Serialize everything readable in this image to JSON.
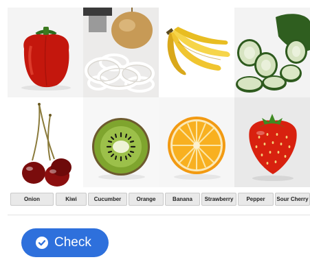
{
  "images": [
    {
      "name": "bell pepper"
    },
    {
      "name": "onion"
    },
    {
      "name": "banana"
    },
    {
      "name": "cucumber"
    },
    {
      "name": "sour cherry"
    },
    {
      "name": "kiwi"
    },
    {
      "name": "orange"
    },
    {
      "name": "strawberry"
    }
  ],
  "labels": [
    "Onion",
    "Kiwi",
    "Cucumber",
    "Orange",
    "Banana",
    "Strawberry",
    "Pepper",
    "Sour Cherry"
  ],
  "check_button": {
    "label": "Check",
    "icon": "check-circle-icon"
  },
  "colors": {
    "accent": "#2e70dc",
    "label_bg": "#e9e9e9"
  }
}
